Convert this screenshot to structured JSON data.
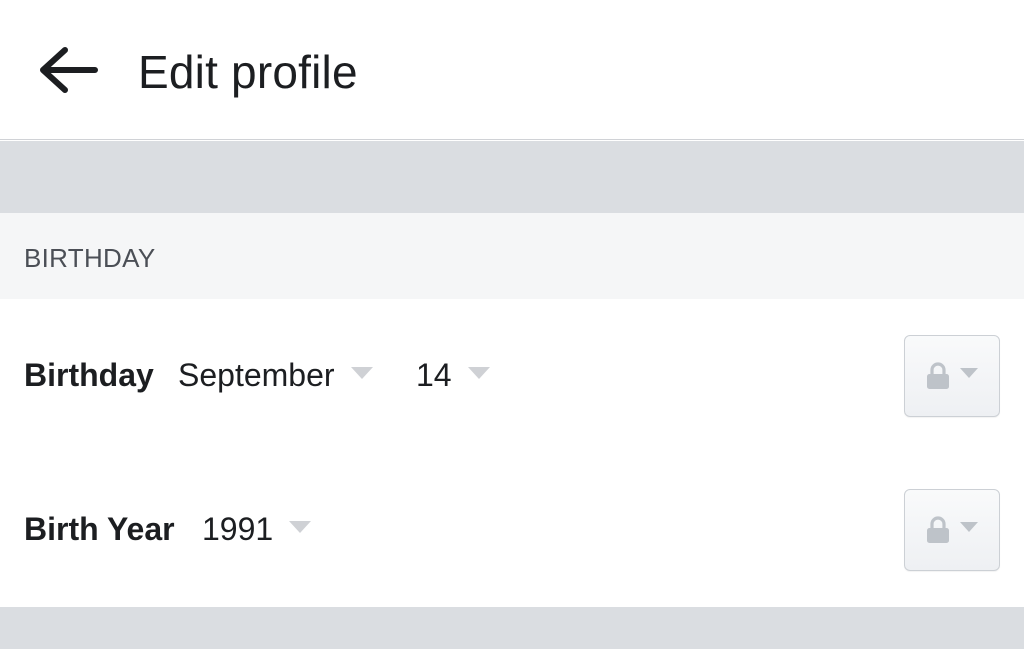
{
  "header": {
    "back_icon": "arrow-left-icon",
    "title": "Edit profile"
  },
  "section": {
    "title": "BIRTHDAY"
  },
  "birthday_row": {
    "label": "Birthday",
    "month": "September",
    "day": "14",
    "privacy_icon": "lock-icon"
  },
  "birthyear_row": {
    "label": "Birth Year",
    "year": "1991",
    "privacy_icon": "lock-icon"
  },
  "colors": {
    "background": "#ffffff",
    "divider_band": "#dadde1",
    "section_header": "#f5f6f7",
    "text_primary": "#1c1e21",
    "text_secondary": "#4b4f56",
    "icon_gray": "#bec3c9"
  }
}
